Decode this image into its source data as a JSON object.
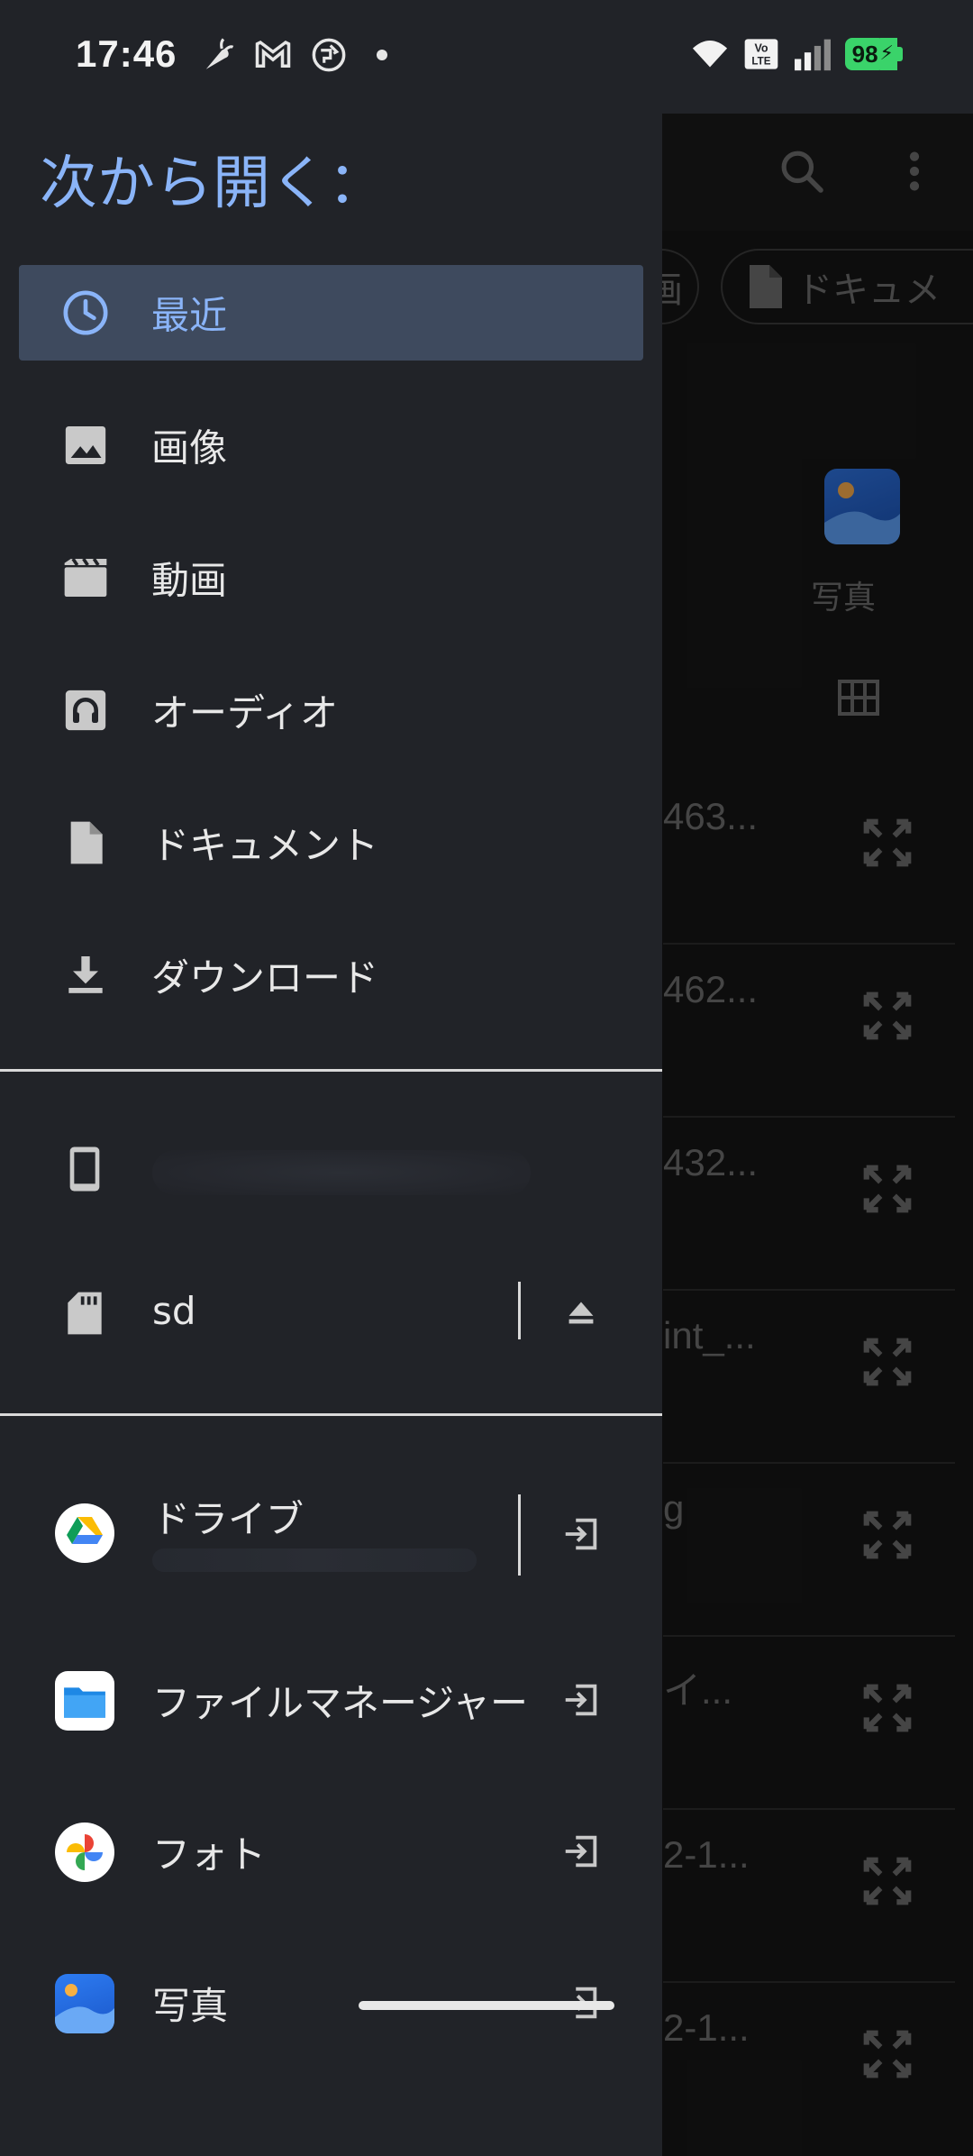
{
  "status_bar": {
    "time": "17:46",
    "notification_icons": [
      "carrot-icon",
      "gmail-icon",
      "vpn-globe-icon",
      "dot-icon"
    ],
    "system_icons": [
      "wifi-icon",
      "volte-icon",
      "cell-signal-icon"
    ],
    "volte_label": "Vo\nLTE",
    "battery_level": "98"
  },
  "drawer": {
    "title": "次から開く：",
    "nav_items": [
      {
        "label": "最近",
        "icon": "clock-icon",
        "active": true
      },
      {
        "label": "画像",
        "icon": "image-icon",
        "active": false
      },
      {
        "label": "動画",
        "icon": "video-icon",
        "active": false
      },
      {
        "label": "オーディオ",
        "icon": "audio-icon",
        "active": false
      },
      {
        "label": "ドキュメント",
        "icon": "document-icon",
        "active": false
      },
      {
        "label": "ダウンロード",
        "icon": "download-icon",
        "active": false
      }
    ],
    "device_roots": [
      {
        "label": "",
        "icon": "phone-icon"
      },
      {
        "label": "sd",
        "icon": "sd-card-icon",
        "action": "eject-icon"
      }
    ],
    "app_roots": [
      {
        "label": "ドライブ",
        "icon": "google-drive-icon",
        "action": "open-in-icon"
      },
      {
        "label": "ファイルマネージャー",
        "icon": "file-manager-icon",
        "action": "open-in-icon"
      },
      {
        "label": "フォト",
        "icon": "google-photos-icon",
        "action": "open-in-icon"
      },
      {
        "label": "写真",
        "icon": "gallery-icon",
        "action": "open-in-icon"
      }
    ]
  },
  "background": {
    "chip_partial": "画",
    "chip_document": "ドキュメ",
    "album_label": "写真",
    "rows": [
      "463...",
      "462...",
      "432...",
      "int_...",
      "g",
      "イ...",
      "2-1...",
      "2-1..."
    ]
  },
  "colors": {
    "drawer_bg": "#212328",
    "accent": "#8ab4f8",
    "active_bg": "#3e4a5e",
    "battery": "#3ad36a"
  }
}
